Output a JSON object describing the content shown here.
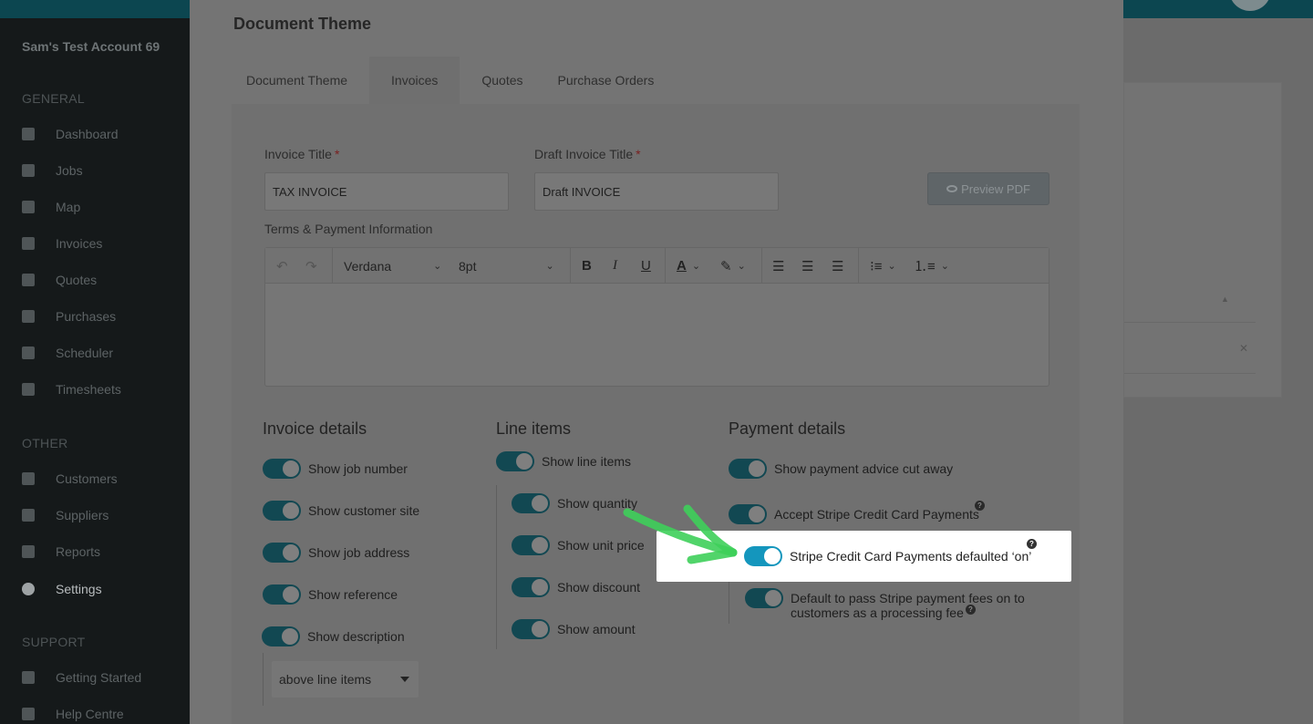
{
  "app": {
    "account_name": "Sam's Test Account 69"
  },
  "sidebar": {
    "sections": [
      {
        "title": "GENERAL",
        "items": [
          {
            "label": "Dashboard",
            "icon": "dashboard-icon"
          },
          {
            "label": "Jobs",
            "icon": "wrench-icon"
          },
          {
            "label": "Map",
            "icon": "map-pin-icon"
          },
          {
            "label": "Invoices",
            "icon": "invoice-icon"
          },
          {
            "label": "Quotes",
            "icon": "calculator-icon"
          },
          {
            "label": "Purchases",
            "icon": "cart-icon"
          },
          {
            "label": "Scheduler",
            "icon": "calendar-icon"
          },
          {
            "label": "Timesheets",
            "icon": "clock-icon"
          }
        ]
      },
      {
        "title": "OTHER",
        "items": [
          {
            "label": "Customers",
            "icon": "users-icon"
          },
          {
            "label": "Suppliers",
            "icon": "truck-icon"
          },
          {
            "label": "Reports",
            "icon": "pie-chart-icon"
          },
          {
            "label": "Settings",
            "icon": "gear-icon",
            "active": true
          }
        ]
      },
      {
        "title": "SUPPORT",
        "items": [
          {
            "label": "Getting Started",
            "icon": "hand-pointer-icon"
          },
          {
            "label": "Help Centre",
            "icon": "book-icon"
          }
        ]
      }
    ]
  },
  "modal": {
    "title": "Document Theme",
    "tabs": [
      "Document Theme",
      "Invoices",
      "Quotes",
      "Purchase Orders"
    ],
    "active_tab": "Invoices",
    "invoice_title_label": "Invoice Title",
    "invoice_title_value": "TAX INVOICE",
    "draft_title_label": "Draft Invoice Title",
    "draft_title_value": "Draft INVOICE",
    "required_mark": "*",
    "preview_button": "Preview PDF",
    "terms_label": "Terms & Payment Information",
    "editor": {
      "font": "Verdana",
      "size": "8pt",
      "bold": "B",
      "italic": "I",
      "underline": "U",
      "text_color": "A"
    },
    "invoice_details": {
      "heading": "Invoice details",
      "toggles": [
        "Show job number",
        "Show customer site",
        "Show job address",
        "Show reference",
        "Show description"
      ],
      "description_position": "above line items"
    },
    "line_items": {
      "heading": "Line items",
      "main_toggle": "Show line items",
      "toggles": [
        "Show quantity",
        "Show unit price",
        "Show discount",
        "Show amount"
      ]
    },
    "payment_details": {
      "heading": "Payment details",
      "toggles": [
        "Show payment advice cut away",
        "Accept Stripe Credit Card Payments"
      ],
      "highlighted_toggle": "Stripe Credit Card Payments defaulted ‘on’",
      "fee_toggle_line1": "Default to pass Stripe payment fees on to",
      "fee_toggle_line2": "customers as a processing fee",
      "help_glyph": "?"
    }
  },
  "colors": {
    "highlight_toggle": "#1496bd",
    "arrow": "#3ecf5a",
    "overlay": "#6b6b6b"
  }
}
